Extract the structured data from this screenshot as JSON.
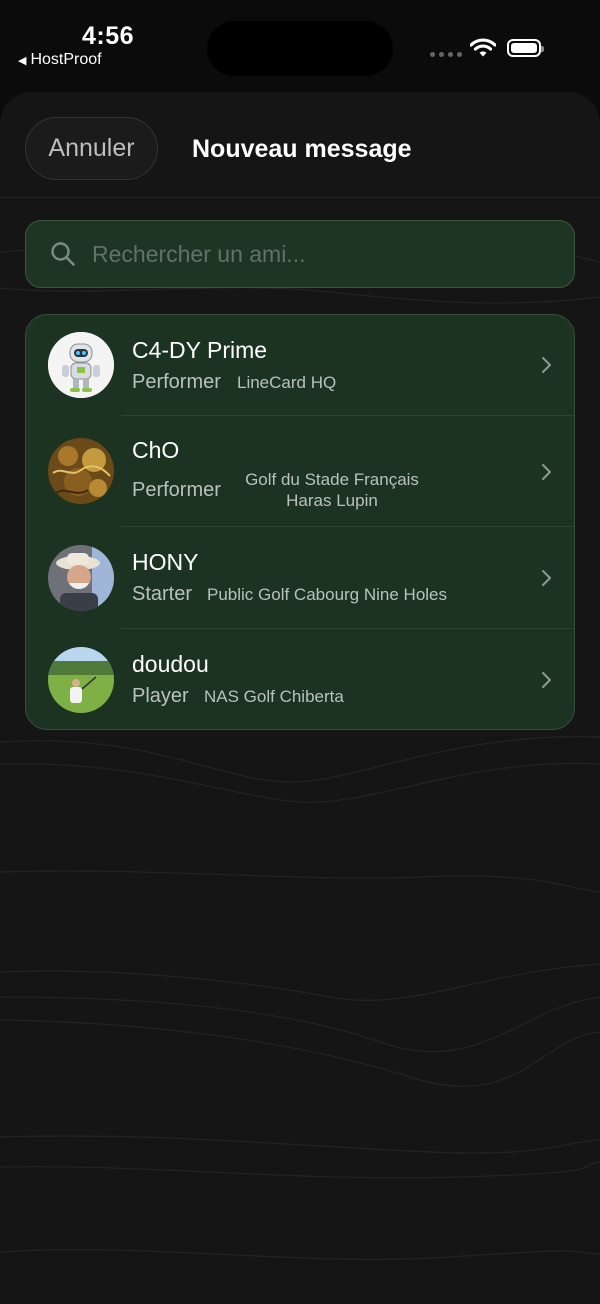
{
  "status_bar": {
    "time": "4:56",
    "back_app": "HostProof"
  },
  "header": {
    "cancel_label": "Annuler",
    "title": "Nouveau message"
  },
  "search": {
    "placeholder": "Rechercher un ami...",
    "value": ""
  },
  "friends": [
    {
      "name": "C4-DY Prime",
      "level": "Performer",
      "clubs": [
        "LineCard HQ"
      ]
    },
    {
      "name": "ChO",
      "level": "Performer",
      "clubs": [
        "Golf du Stade Français",
        "Haras Lupin"
      ]
    },
    {
      "name": "HONY",
      "level": "Starter",
      "clubs": [
        "Public Golf Cabourg Nine Holes"
      ]
    },
    {
      "name": "doudou",
      "level": "Player",
      "clubs": [
        "NAS Golf Chiberta"
      ]
    }
  ],
  "colors": {
    "sheet_bg": "#151515",
    "card_bg": "#1d3322",
    "accent_border": "#34503a"
  }
}
